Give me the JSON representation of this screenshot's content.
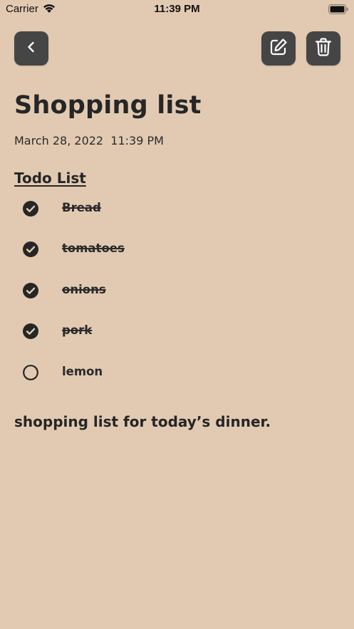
{
  "status_bar": {
    "carrier": "Carrier",
    "time": "11:39 PM"
  },
  "icons": {
    "back": "chevron-left-icon",
    "edit": "edit-pencil-icon",
    "delete": "trash-icon",
    "checked": "check-circle-filled-icon",
    "unchecked": "circle-outline-icon"
  },
  "colors": {
    "background": "#e2cab2",
    "button": "#454545",
    "text": "#262626"
  },
  "note": {
    "title": "Shopping list",
    "date": "March 28, 2022  11:39 PM",
    "todo_heading": "Todo List",
    "todos": [
      {
        "label": "Bread",
        "done": true
      },
      {
        "label": "tomatoes",
        "done": true
      },
      {
        "label": "onions",
        "done": true
      },
      {
        "label": "pork",
        "done": true
      },
      {
        "label": "lemon",
        "done": false
      }
    ],
    "body": "shopping list for today’s dinner."
  }
}
